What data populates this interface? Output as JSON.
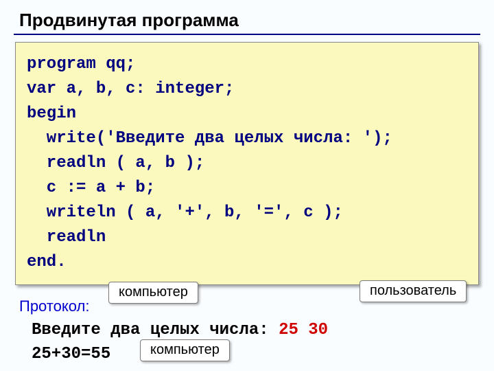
{
  "title": "Продвинутая программа",
  "code": "program qq;\nvar a, b, c: integer;\nbegin\n  write('Введите два целых числа: ');\n  readln ( a, b );\n  c := a + b;\n  writeln ( a, '+', b, '=', c );\n  readln\nend.",
  "protocol_label": "Протокол:",
  "output": {
    "prompt": "Введите два целых числа:",
    "user_input": "25 30",
    "result": "25+30=55"
  },
  "callouts": {
    "computer1": "компьютер",
    "user": "пользователь",
    "computer2": "компьютер"
  }
}
